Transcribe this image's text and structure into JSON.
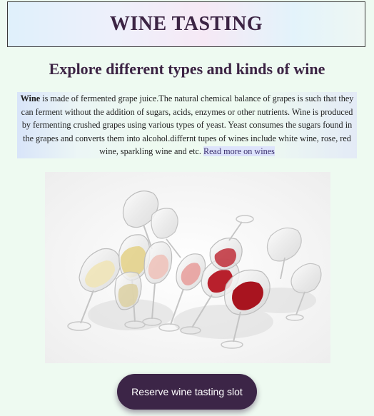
{
  "header": {
    "title": "WINE TASTING"
  },
  "main": {
    "subtitle": "Explore different types and kinds of wine",
    "intro_bold": "Wine",
    "intro_text": " is made of fermented grape juice.The natural chemical balance of grapes is such that they can ferment without the addition of sugars, acids, enzymes or other nutrients. Wine is produced by fermenting crushed grapes using various types of yeast. Yeast consumes the sugars found in the grapes and converts them into alcohol.differnt tupes of wines include white wine, rose, red wine, sparkling wine and etc. ",
    "read_more": "Read more on wines",
    "image_icon": "wine-glasses-photo",
    "reserve_button": "Reserve wine tasting slot"
  },
  "colors": {
    "background": "#eefaf1",
    "heading": "#3c2444",
    "button": "#3c2547",
    "link": "#3a2f6e",
    "red_wine": "#b3202b",
    "rose_wine": "#e39a98",
    "white_wine": "#e9d8a0"
  }
}
